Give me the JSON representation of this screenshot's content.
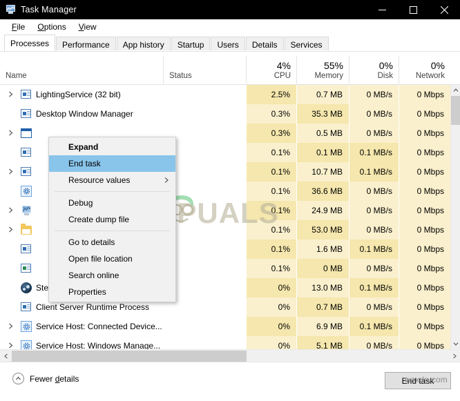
{
  "window": {
    "title": "Task Manager",
    "icon": "task-manager-icon",
    "buttons": {
      "minimize": "–",
      "maximize": "□",
      "close": "✕"
    }
  },
  "menubar": {
    "items": [
      {
        "label": "File",
        "accel": "F"
      },
      {
        "label": "Options",
        "accel": "O"
      },
      {
        "label": "View",
        "accel": "V"
      }
    ]
  },
  "tabs": [
    {
      "label": "Processes",
      "active": true
    },
    {
      "label": "Performance",
      "active": false
    },
    {
      "label": "App history",
      "active": false
    },
    {
      "label": "Startup",
      "active": false
    },
    {
      "label": "Users",
      "active": false
    },
    {
      "label": "Details",
      "active": false
    },
    {
      "label": "Services",
      "active": false
    }
  ],
  "columns": [
    {
      "key": "name",
      "label": "Name",
      "pct": "",
      "align": "left"
    },
    {
      "key": "status",
      "label": "Status",
      "pct": "",
      "align": "left"
    },
    {
      "key": "cpu",
      "label": "CPU",
      "pct": "4%",
      "align": "right",
      "sorted": true
    },
    {
      "key": "memory",
      "label": "Memory",
      "pct": "55%",
      "align": "right"
    },
    {
      "key": "disk",
      "label": "Disk",
      "pct": "0%",
      "align": "right"
    },
    {
      "key": "network",
      "label": "Network",
      "pct": "0%",
      "align": "right"
    }
  ],
  "rows": [
    {
      "name": "LightingService (32 bit)",
      "expandable": true,
      "icon": "document-icon",
      "status": "",
      "cpu": "2.5%",
      "memory": "0.7 MB",
      "disk": "0 MB/s",
      "network": "0 Mbps"
    },
    {
      "name": "Desktop Window Manager",
      "expandable": false,
      "icon": "document-icon",
      "status": "",
      "cpu": "0.3%",
      "memory": "35.3 MB",
      "disk": "0 MB/s",
      "network": "0 Mbps"
    },
    {
      "name": "",
      "expandable": true,
      "icon": "window-icon",
      "status": "",
      "cpu": "0.3%",
      "memory": "0.5 MB",
      "disk": "0 MB/s",
      "network": "0 Mbps"
    },
    {
      "name": "",
      "expandable": false,
      "icon": "document-icon",
      "status": "",
      "cpu": "0.1%",
      "memory": "0.1 MB",
      "disk": "0.1 MB/s",
      "network": "0 Mbps"
    },
    {
      "name": "",
      "expandable": true,
      "icon": "document-icon",
      "status": "",
      "cpu": "0.1%",
      "memory": "10.7 MB",
      "disk": "0.1 MB/s",
      "network": "0 Mbps"
    },
    {
      "name": "",
      "expandable": false,
      "icon": "gear-monitor-icon",
      "status": "",
      "cpu": "0.1%",
      "memory": "36.6 MB",
      "disk": "0 MB/s",
      "network": "0 Mbps"
    },
    {
      "name": "",
      "expandable": true,
      "icon": "task-manager-icon",
      "status": "",
      "cpu": "0.1%",
      "memory": "24.9 MB",
      "disk": "0 MB/s",
      "network": "0 Mbps"
    },
    {
      "name": "",
      "expandable": true,
      "icon": "folder-icon",
      "status": "",
      "cpu": "0.1%",
      "memory": "53.0 MB",
      "disk": "0 MB/s",
      "network": "0 Mbps"
    },
    {
      "name": "",
      "expandable": false,
      "icon": "document-icon",
      "status": "",
      "cpu": "0.1%",
      "memory": "1.6 MB",
      "disk": "0.1 MB/s",
      "network": "0 Mbps"
    },
    {
      "name": "",
      "expandable": false,
      "icon": "document-green-icon",
      "status": "",
      "cpu": "0.1%",
      "memory": "0 MB",
      "disk": "0 MB/s",
      "network": "0 Mbps"
    },
    {
      "name": "Steam Client Bootstrapper (32 bit)",
      "expandable": false,
      "icon": "steam-icon",
      "status": "",
      "cpu": "0%",
      "memory": "13.0 MB",
      "disk": "0.1 MB/s",
      "network": "0 Mbps"
    },
    {
      "name": "Client Server Runtime Process",
      "expandable": false,
      "icon": "document-icon",
      "status": "",
      "cpu": "0%",
      "memory": "0.7 MB",
      "disk": "0 MB/s",
      "network": "0 Mbps"
    },
    {
      "name": "Service Host: Connected Device...",
      "expandable": true,
      "icon": "gear-icon",
      "status": "",
      "cpu": "0%",
      "memory": "6.9 MB",
      "disk": "0.1 MB/s",
      "network": "0 Mbps"
    },
    {
      "name": "Service Host: Windows Manage...",
      "expandable": true,
      "icon": "gear-icon",
      "status": "",
      "cpu": "0%",
      "memory": "5.1 MB",
      "disk": "0 MB/s",
      "network": "0 Mbps"
    }
  ],
  "context_menu": {
    "items": [
      {
        "label": "Expand",
        "bold": true,
        "selected": false,
        "submenu": false
      },
      {
        "label": "End task",
        "bold": false,
        "selected": true,
        "submenu": false
      },
      {
        "label": "Resource values",
        "bold": false,
        "selected": false,
        "submenu": true
      },
      {
        "separator": true
      },
      {
        "label": "Debug",
        "bold": false,
        "selected": false,
        "submenu": false
      },
      {
        "label": "Create dump file",
        "bold": false,
        "selected": false,
        "submenu": false
      },
      {
        "separator": true
      },
      {
        "label": "Go to details",
        "bold": false,
        "selected": false,
        "submenu": false
      },
      {
        "label": "Open file location",
        "bold": false,
        "selected": false,
        "submenu": false
      },
      {
        "label": "Search online",
        "bold": false,
        "selected": false,
        "submenu": false
      },
      {
        "label": "Properties",
        "bold": false,
        "selected": false,
        "submenu": false
      }
    ]
  },
  "bottom": {
    "fewer_details": "Fewer details",
    "fewer_details_pre": "Fewer ",
    "fewer_details_accel": "d",
    "fewer_details_post": "etails",
    "end_task": "End task"
  },
  "watermark": {
    "text": "APPUALS",
    "url": "wsxdn.com"
  },
  "colors": {
    "titlebar": "#000000",
    "heat_band": "#f5e7ad",
    "heat_band_light": "#faf0cd",
    "selection": "#89c4ea",
    "accent_blue": "#1f5fa9"
  }
}
